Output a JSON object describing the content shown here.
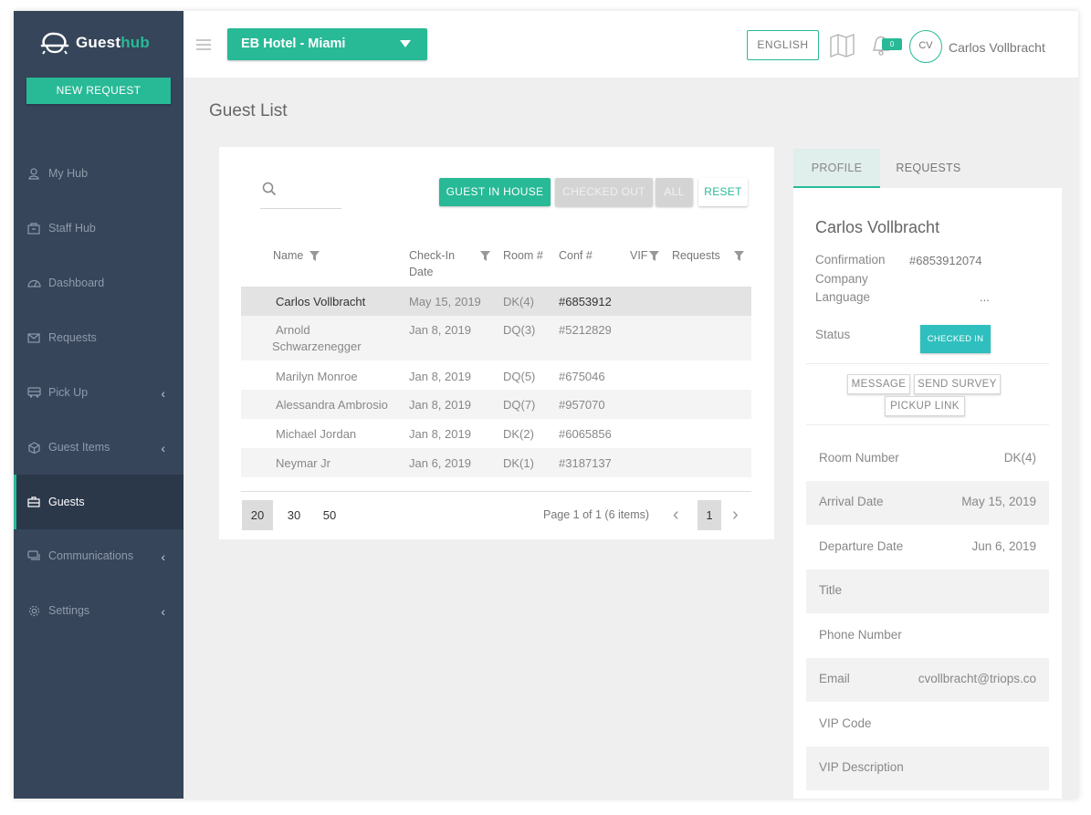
{
  "app": {
    "logo_word_a": "Guest",
    "logo_word_b": "hub"
  },
  "sidebar": {
    "new_request": "NEW REQUEST",
    "items": [
      {
        "label": "My Hub"
      },
      {
        "label": "Staff Hub"
      },
      {
        "label": "Dashboard"
      },
      {
        "label": "Requests"
      },
      {
        "label": "Pick Up"
      },
      {
        "label": "Guest Items"
      },
      {
        "label": "Guests"
      },
      {
        "label": "Communications"
      },
      {
        "label": "Settings"
      }
    ]
  },
  "topbar": {
    "hotel": "EB Hotel - Miami",
    "language": "ENGLISH",
    "notification_count": "0",
    "avatar_initials": "CV",
    "user_name": "Carlos Vollbracht"
  },
  "page": {
    "title": "Guest List"
  },
  "filters": {
    "search_placeholder": "",
    "guest_in_house": "GUEST IN HOUSE",
    "checked_out": "CHECKED OUT",
    "all": "ALL",
    "reset": "RESET"
  },
  "table": {
    "headers": {
      "name": "Name",
      "checkin_a": "Check-In",
      "checkin_b": "Date",
      "room": "Room #",
      "conf": "Conf #",
      "vip": "VIF",
      "requests": "Requests"
    },
    "rows": [
      {
        "name": "Carlos Vollbracht",
        "name2": "",
        "date": "May 15, 2019",
        "room": "DK(4)",
        "conf": "#6853912"
      },
      {
        "name": "Arnold",
        "name2": "Schwarzenegger",
        "date": "Jan 8, 2019",
        "room": "DQ(3)",
        "conf": "#5212829"
      },
      {
        "name": "Marilyn Monroe",
        "name2": "",
        "date": "Jan 8, 2019",
        "room": "DQ(5)",
        "conf": "#675046"
      },
      {
        "name": "Alessandra Ambrosio",
        "name2": "",
        "date": "Jan 8, 2019",
        "room": "DQ(7)",
        "conf": "#957070"
      },
      {
        "name": "Michael Jordan",
        "name2": "",
        "date": "Jan 8, 2019",
        "room": "DK(2)",
        "conf": "#6065856"
      },
      {
        "name": "Neymar Jr",
        "name2": "",
        "date": "Jan 6, 2019",
        "room": "DK(1)",
        "conf": "#3187137"
      }
    ]
  },
  "pagination": {
    "sizes": [
      "20",
      "30",
      "50"
    ],
    "info": "Page 1 of 1 (6 items)",
    "current": "1"
  },
  "profile": {
    "tabs": {
      "profile": "PROFILE",
      "requests": "REQUESTS"
    },
    "name": "Carlos Vollbracht",
    "confirmation_label": "Confirmation",
    "confirmation_value": "#6853912074",
    "company_label": "Company",
    "language_label": "Language",
    "language_value": "...",
    "status_label": "Status",
    "status_value": "CHECKED IN",
    "actions": {
      "message": "MESSAGE",
      "send_survey": "SEND SURVEY",
      "pickup_link": "PICKUP LINK"
    },
    "fields": [
      {
        "label": "Room Number",
        "value": "DK(4)"
      },
      {
        "label": "Arrival Date",
        "value": "May 15, 2019"
      },
      {
        "label": "Departure Date",
        "value": "Jun 6, 2019"
      },
      {
        "label": "Title",
        "value": ""
      },
      {
        "label": "Phone Number",
        "value": ""
      },
      {
        "label": "Email",
        "value": "cvollbracht@triops.co"
      },
      {
        "label": "VIP Code",
        "value": ""
      },
      {
        "label": "VIP Description",
        "value": ""
      }
    ]
  },
  "colors": {
    "accent": "#28b996",
    "sidebar_bg": "#36455a",
    "status": "#2fbfbf"
  }
}
